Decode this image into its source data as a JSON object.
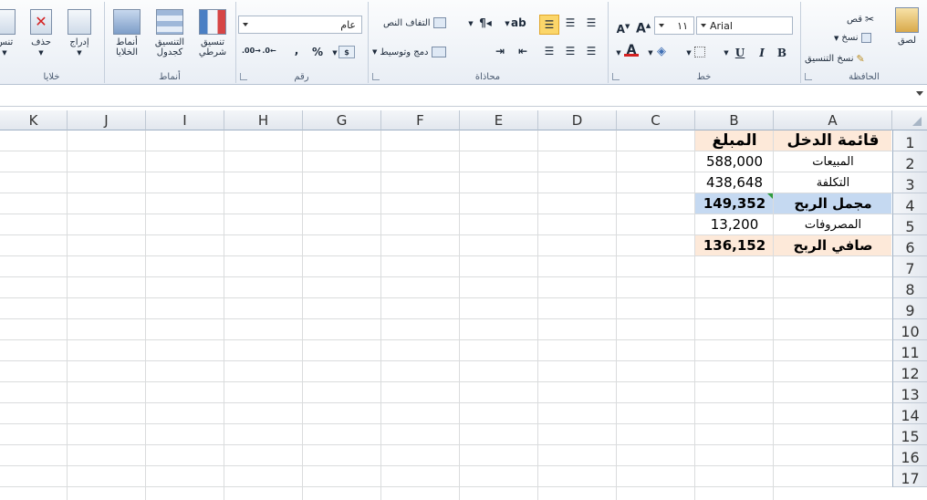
{
  "ribbon": {
    "clipboard": {
      "group_label": "الحافظة",
      "paste": "لصق",
      "cut": "قص",
      "copy": "نسخ",
      "format_painter": "نسخ التنسيق"
    },
    "font": {
      "group_label": "خط",
      "font_name": "Arial",
      "font_size": "١١",
      "bold": "B",
      "italic": "I",
      "underline": "U"
    },
    "alignment": {
      "group_label": "محاذاة",
      "wrap_text": "التفاف النص",
      "merge_center": "دمج وتوسيط"
    },
    "number": {
      "group_label": "رقم",
      "format": "عام",
      "percent": "%",
      "comma": ","
    },
    "styles": {
      "group_label": "أنماط",
      "conditional": "تنسيق شرطي",
      "as_table": "التنسيق كجدول",
      "cell_styles": "أنماط الخلايا"
    },
    "cells": {
      "group_label": "خلايا",
      "insert": "إدراج",
      "delete": "حذف",
      "format": "تنس"
    }
  },
  "columns": [
    "K",
    "J",
    "I",
    "H",
    "G",
    "F",
    "E",
    "D",
    "C",
    "B",
    "A"
  ],
  "rows": [
    "1",
    "2",
    "3",
    "4",
    "5",
    "6",
    "7",
    "8",
    "9",
    "10",
    "11",
    "12",
    "13",
    "14",
    "15",
    "16",
    "17"
  ],
  "cells": {
    "A1": "قائمة الدخل",
    "B1": "المبلغ",
    "A2": "المبيعات",
    "B2": "588,000",
    "A3": "التكلفة",
    "B3": "438,648",
    "A4": "مجمل الربح",
    "B4": "149,352",
    "A5": "المصروفات",
    "B5": "13,200",
    "A6": "صافي الربح",
    "B6": "136,152"
  },
  "colors": {
    "header_fill": "#fde9d9",
    "gross_profit_fill": "#c5d9f1",
    "net_profit_fill": "#fde9d9",
    "error_indicator": "#2e9b3e"
  }
}
